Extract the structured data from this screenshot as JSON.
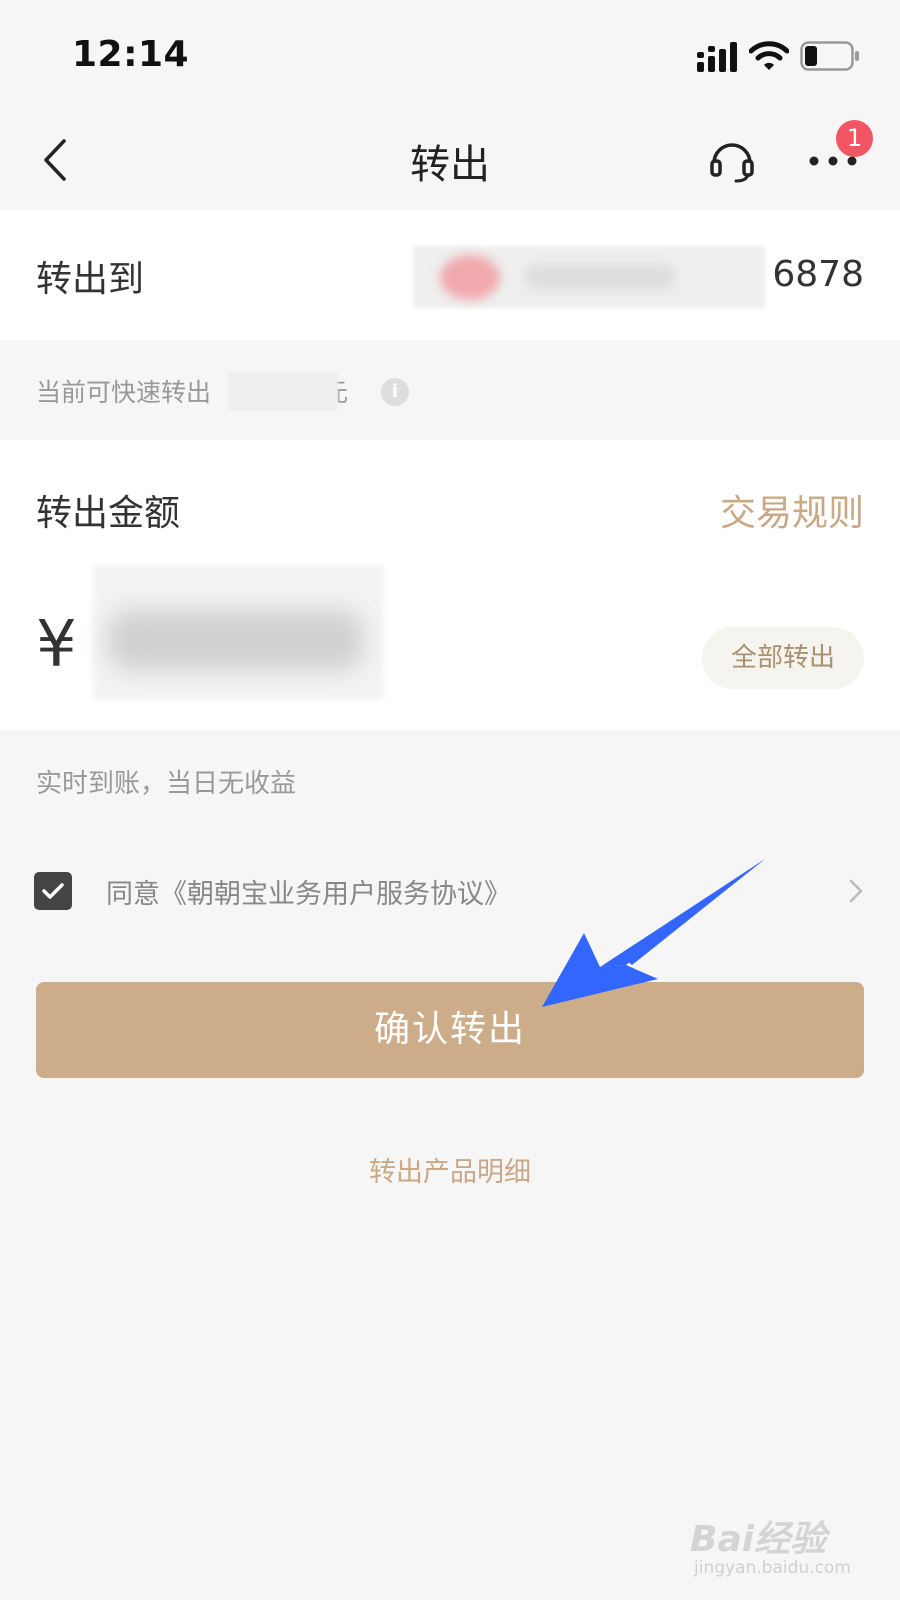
{
  "status_bar": {
    "time": "12:14"
  },
  "nav": {
    "title": "转出",
    "badge_count": "1",
    "icons": [
      "back-icon",
      "headset-icon",
      "more-icon"
    ]
  },
  "transfer_to": {
    "label": "转出到",
    "account_suffix": "6878"
  },
  "quick_transfer": {
    "prefix": "当前可快速转出",
    "suffix": "元",
    "info_glyph": "i"
  },
  "amount": {
    "label": "转出金额",
    "rules_link": "交易规则",
    "currency": "¥",
    "all_out_button": "全部转出"
  },
  "note": "实时到账，当日无收益",
  "agreement": {
    "checked": true,
    "text": "同意《朝朝宝业务用户服务协议》"
  },
  "confirm_button": "确认转出",
  "detail_link": "转出产品明细",
  "watermark": {
    "main": "Bai经验",
    "sub": "jingyan.baidu.com"
  },
  "colors": {
    "accent": "#cdac8a",
    "link": "#c9a886",
    "badge": "#f25563",
    "annotation_arrow": "#3366ff"
  }
}
